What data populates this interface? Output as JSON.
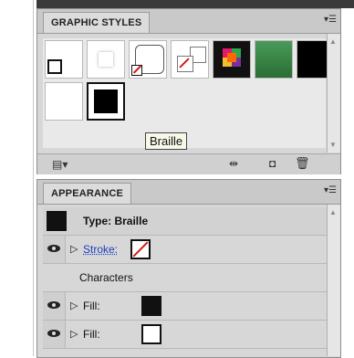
{
  "graphic_styles": {
    "tab_label": "GRAPHIC STYLES",
    "tooltip": "Braille",
    "swatches": [
      {
        "name": "default-style"
      },
      {
        "name": "blank-style"
      },
      {
        "name": "rounded-none-style"
      },
      {
        "name": "none-fill-style"
      },
      {
        "name": "mosaic-style"
      },
      {
        "name": "green-gradient-style"
      },
      {
        "name": "black-fill-style"
      },
      {
        "name": "white-style"
      },
      {
        "name": "braille-style"
      }
    ]
  },
  "appearance": {
    "tab_label": "APPEARANCE",
    "type_label": "Type: Braille",
    "stroke_label": "Stroke:",
    "characters_label": "Characters",
    "fill_label_1": "Fill:",
    "fill_label_2": "Fill:",
    "colors": {
      "fill_1": "#111111",
      "fill_2": "#ffffff",
      "stroke_none": "#d01a1a"
    }
  }
}
